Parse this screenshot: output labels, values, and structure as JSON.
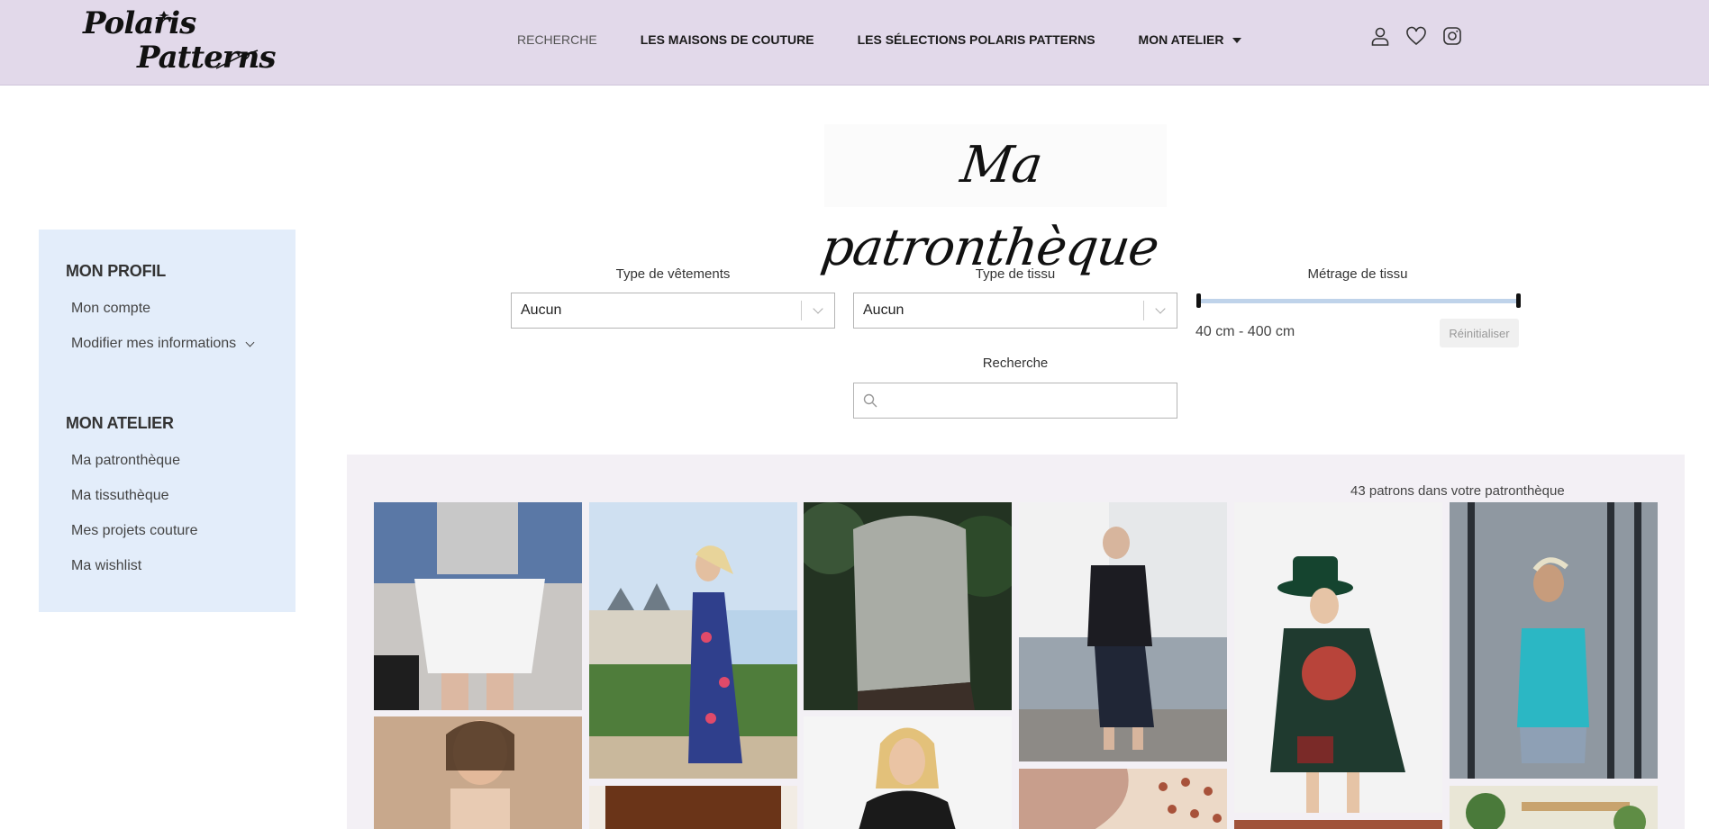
{
  "header": {
    "logo": {
      "line1": "Polaris",
      "line2": "Patterns"
    },
    "nav": [
      {
        "label": "RECHERCHE"
      },
      {
        "label": "LES MAISONS DE COUTURE"
      },
      {
        "label": "LES SÉLECTIONS POLARIS PATTERNS"
      },
      {
        "label": "MON ATELIER"
      }
    ],
    "icons": [
      "user-icon",
      "heart-icon",
      "instagram-icon"
    ]
  },
  "page": {
    "title": "Ma patronthèque"
  },
  "sidebar": {
    "profile_heading": "MON PROFIL",
    "profile_links": [
      "Mon compte",
      "Modifier mes informations"
    ],
    "atelier_heading": "MON ATELIER",
    "atelier_links": [
      "Ma patronthèque",
      "Ma tissuthèque",
      "Mes projets couture",
      "Ma wishlist"
    ]
  },
  "filters": {
    "clothing": {
      "label": "Type de vêtements",
      "value": "Aucun"
    },
    "fabric": {
      "label": "Type de tissu",
      "value": "Aucun"
    },
    "length": {
      "label": "Métrage de tissu",
      "range_text": "40 cm - 400 cm",
      "min": 40,
      "max": 400,
      "low": 40,
      "high": 400,
      "reset_label": "Réinitialiser"
    },
    "search": {
      "label": "Recherche",
      "value": "",
      "placeholder": ""
    }
  },
  "gallery": {
    "count_text": "43 patrons dans votre patronthèque"
  },
  "colors": {
    "header_bg": "#e2d9ea",
    "sidebar_bg": "#e3edfa",
    "gallery_bg": "#f3f0f5",
    "slider_track": "#bfd3ea"
  }
}
